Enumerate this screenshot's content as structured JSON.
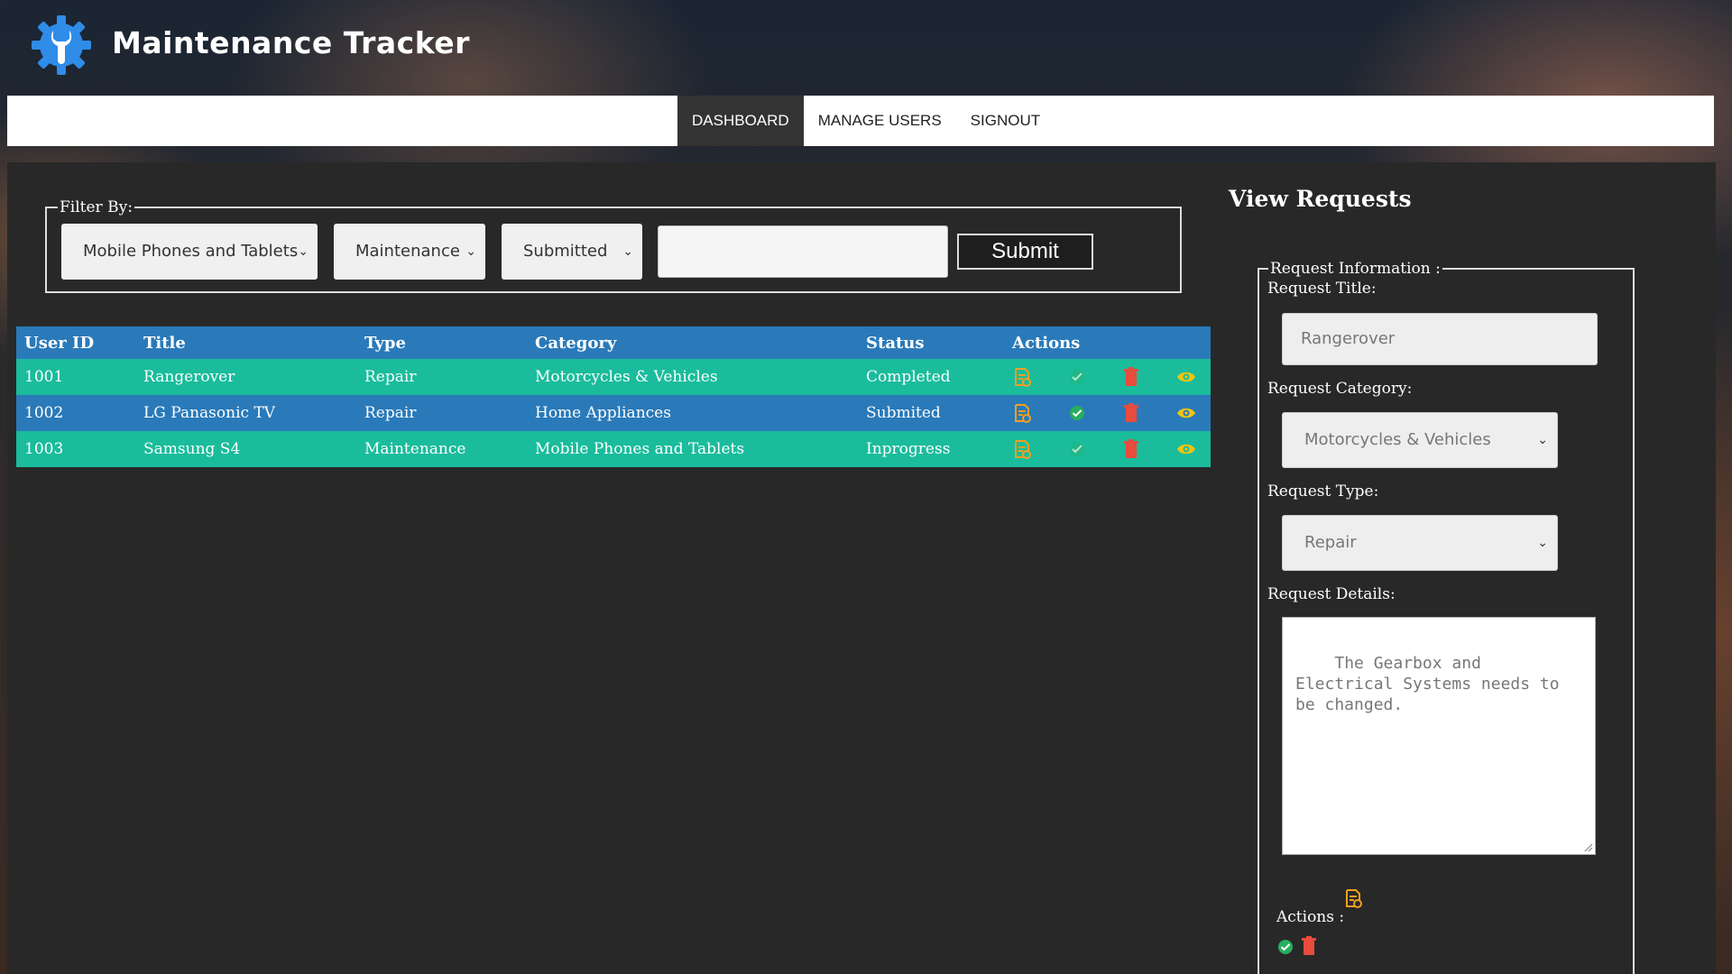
{
  "app": {
    "title": "Maintenance Tracker",
    "logo_icon": "gear-wrench-icon"
  },
  "nav": {
    "items": [
      {
        "label": "DASHBOARD",
        "active": true
      },
      {
        "label": "MANAGE USERS",
        "active": false
      },
      {
        "label": "SIGNOUT",
        "active": false
      }
    ]
  },
  "filter": {
    "legend": "Filter By:",
    "category": "Mobile Phones and Tablets",
    "type": "Maintenance",
    "status": "Submitted",
    "search_value": "",
    "submit_label": "Submit"
  },
  "table": {
    "headers": [
      "User ID",
      "Title",
      "Type",
      "Category",
      "Status",
      "Actions"
    ],
    "rows": [
      {
        "user_id": "1001",
        "title": "Rangerover",
        "type": "Repair",
        "category": "Motorcycles & Vehicles",
        "status": "Completed"
      },
      {
        "user_id": "1002",
        "title": "LG Panasonic TV",
        "type": "Repair",
        "category": "Home Appliances",
        "status": "Submited"
      },
      {
        "user_id": "1003",
        "title": "Samsung S4",
        "type": "Maintenance",
        "category": "Mobile Phones and Tablets",
        "status": "Inprogress"
      }
    ],
    "action_icons": [
      "edit-icon",
      "approve-icon",
      "delete-icon",
      "view-icon"
    ]
  },
  "side": {
    "title": "View Requests",
    "legend": "Request Information :",
    "title_label": "Request Title:",
    "title_value": "Rangerover",
    "category_label": "Request Category:",
    "category_value": "Motorcycles & Vehicles",
    "type_label": "Request Type:",
    "type_value": "Repair",
    "details_label": "Request Details:",
    "details_value": "The Gearbox and Electrical Systems needs to be changed.",
    "actions_label": "Actions :"
  },
  "colors": {
    "teal": "#1abc9c",
    "blue": "#2a7ab9",
    "edit": "#f0a020",
    "approve": "#27ae60",
    "delete": "#e74c3c",
    "view": "#f1c40f"
  }
}
